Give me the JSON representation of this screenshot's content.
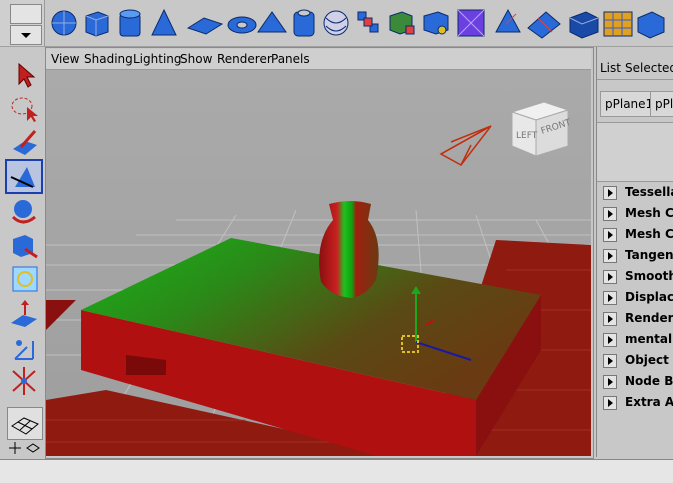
{
  "viewport": {
    "menu": [
      "View",
      "Shading",
      "Lighting",
      "Show",
      "Renderer",
      "Panels"
    ],
    "view_cube": {
      "face_left": "LEFT",
      "face_front": "FRONT"
    }
  },
  "attribute_editor": {
    "menu": [
      "List",
      "Selected"
    ],
    "tabs": [
      "pPlane1",
      "pPla"
    ],
    "sections": [
      "Tessella",
      "Mesh Co",
      "Mesh Co",
      "Tangent",
      "Smooth I",
      "Displace",
      "Render S",
      "mental ra",
      "Object D",
      "Node Be",
      "Extra Att"
    ]
  },
  "colors": {
    "selection_blue": "#1a3fb0",
    "table_top": "#6a3a12",
    "green": "#1ea61e",
    "red": "#c01010"
  }
}
